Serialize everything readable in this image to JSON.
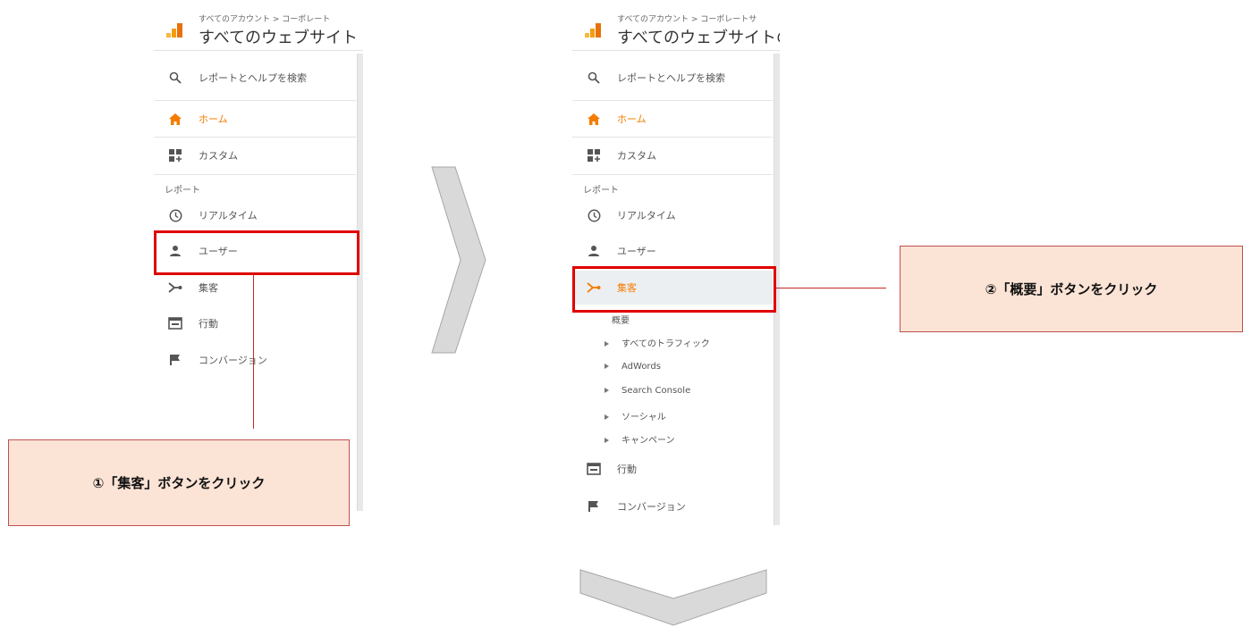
{
  "left_panel": {
    "breadcrumb": "すべてのアカウント > コーポレート",
    "account_title": "すべてのウェブサイト",
    "search_label": "レポートとヘルプを検索",
    "home_label": "ホーム",
    "custom_label": "カスタム",
    "reports_section": "レポート",
    "realtime_label": "リアルタイム",
    "user_label": "ユーザー",
    "acquisition_label": "集客",
    "behavior_label": "行動",
    "conversion_label": "コンバージョン"
  },
  "right_panel": {
    "breadcrumb": "すべてのアカウント > コーポレートサ",
    "account_title": "すべてのウェブサイトの",
    "search_label": "レポートとヘルプを検索",
    "home_label": "ホーム",
    "custom_label": "カスタム",
    "reports_section": "レポート",
    "realtime_label": "リアルタイム",
    "user_label": "ユーザー",
    "acquisition_label": "集客",
    "acquisition_sub": {
      "overview": "概要",
      "all_traffic": "すべてのトラフィック",
      "adwords": "AdWords",
      "search_console": "Search Console",
      "social": "ソーシャル",
      "campaigns": "キャンペーン"
    },
    "behavior_label": "行動",
    "conversion_label": "コンバージョン"
  },
  "callouts": {
    "step1": "①「集客」ボタンをクリック",
    "step2": "②「概要」ボタンをクリック"
  },
  "colors": {
    "accent_orange": "#f57c00",
    "highlight_red": "#e00000",
    "callout_fill": "#fbe3d6",
    "chevron_fill": "#d9d9d9"
  },
  "icons": [
    "search-icon",
    "home-icon",
    "custom-icon",
    "clock-icon",
    "person-icon",
    "acquisition-icon",
    "behavior-icon",
    "flag-icon"
  ]
}
